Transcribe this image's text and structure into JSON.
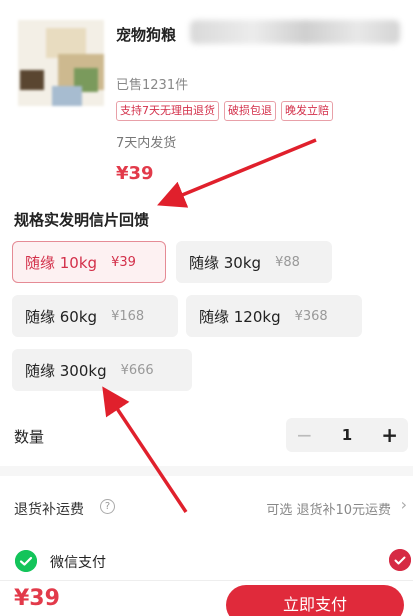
{
  "product": {
    "name": "宠物狗粮",
    "sold": "已售1231件",
    "tags": [
      "支持7天无理由退货",
      "破损包退",
      "晚发立赔"
    ],
    "shipping": "7天内发货",
    "price": "¥39"
  },
  "spec": {
    "title": "规格实发明信片回馈",
    "options": [
      {
        "label": "随缘 10kg",
        "price": "¥39",
        "selected": true
      },
      {
        "label": "随缘 30kg",
        "price": "¥88",
        "selected": false
      },
      {
        "label": "随缘 60kg",
        "price": "¥168",
        "selected": false
      },
      {
        "label": "随缘 120kg",
        "price": "¥368",
        "selected": false
      },
      {
        "label": "随缘 300kg",
        "price": "¥666",
        "selected": false
      }
    ]
  },
  "quantity": {
    "label": "数量",
    "minus": "−",
    "value": "1",
    "plus": "+"
  },
  "return_fee": {
    "label": "退货补运费",
    "help_icon": "?",
    "option": "可选 退货补10元运费",
    "chevron": "›"
  },
  "payment": {
    "method": "微信支付",
    "icon": "wechat-pay-icon"
  },
  "footer": {
    "total": "¥39",
    "pay_button": "立即支付"
  },
  "colors": {
    "accent": "#e02a3b",
    "selected_border": "#e58b95",
    "wechat_green": "#13c45a"
  }
}
